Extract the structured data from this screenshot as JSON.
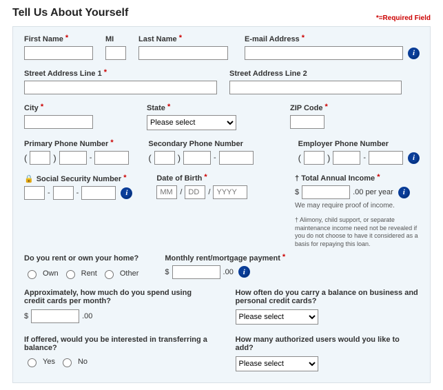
{
  "page": {
    "title": "Tell Us About Yourself",
    "required_note": "*=Required Field"
  },
  "labels": {
    "first_name": "First Name",
    "mi": "MI",
    "last_name": "Last Name",
    "email": "E-mail Address",
    "addr1": "Street Address Line 1",
    "addr2": "Street Address Line 2",
    "city": "City",
    "state": "State",
    "zip": "ZIP Code",
    "pphone": "Primary Phone Number",
    "sphone": "Secondary Phone Number",
    "ephone": "Employer Phone Number",
    "ssn": "Social Security Number",
    "dob": "Date of Birth",
    "income": "Total Annual Income",
    "income_unit": ".00 per year",
    "income_note": "We may require proof of income.",
    "alimony": "† Alimony, child support, or separate maintenance income need not be revealed if you do not choose to have it considered as a basis for repaying this loan.",
    "dagger": "†",
    "dollar": "$",
    "rent_own_q": "Do you rent or own your home?",
    "own": "Own",
    "rent": "Rent",
    "other": "Other",
    "monthly_pay": "Monthly rent/mortgage payment",
    "cents": ".00",
    "cc_spend_q": "Approximately, how much do you spend using credit cards per month?",
    "balance_q": "How often do you carry a balance on business and personal credit cards?",
    "transfer_q": "If offered, would you be interested in transferring a balance?",
    "yes": "Yes",
    "no": "No",
    "auth_users_q": "How many authorized users would you like to add?",
    "please_select": "Please select"
  },
  "ph": {
    "mm": "MM",
    "dd": "DD",
    "yyyy": "YYYY"
  },
  "sep": {
    "slash": "/",
    "dash": "-"
  }
}
